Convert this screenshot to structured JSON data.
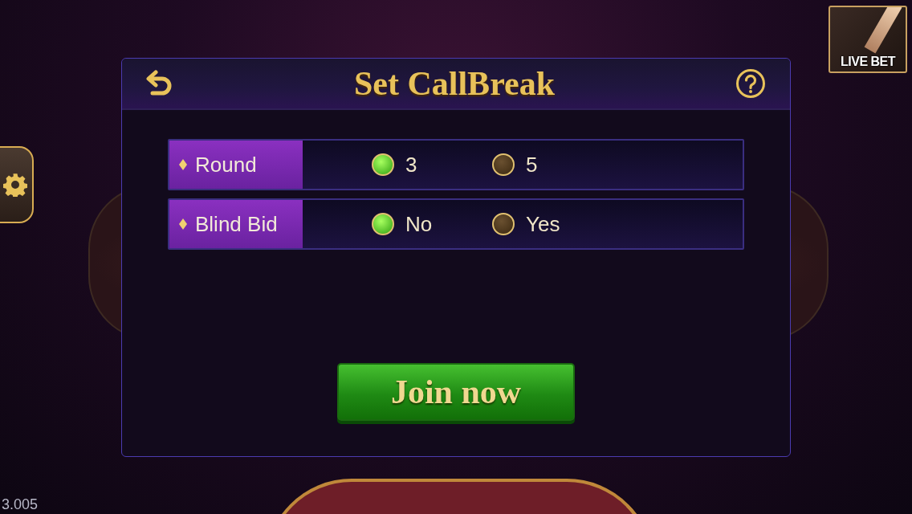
{
  "dialog": {
    "title": "Set CallBreak",
    "settings": [
      {
        "label": "Round",
        "options": [
          {
            "label": "3",
            "selected": true
          },
          {
            "label": "5",
            "selected": false
          }
        ]
      },
      {
        "label": "Blind Bid",
        "options": [
          {
            "label": "No",
            "selected": true
          },
          {
            "label": "Yes",
            "selected": false
          }
        ]
      }
    ],
    "join_button": "Join now"
  },
  "live_bet": {
    "label": "LIVE BET"
  },
  "version": "3.005"
}
